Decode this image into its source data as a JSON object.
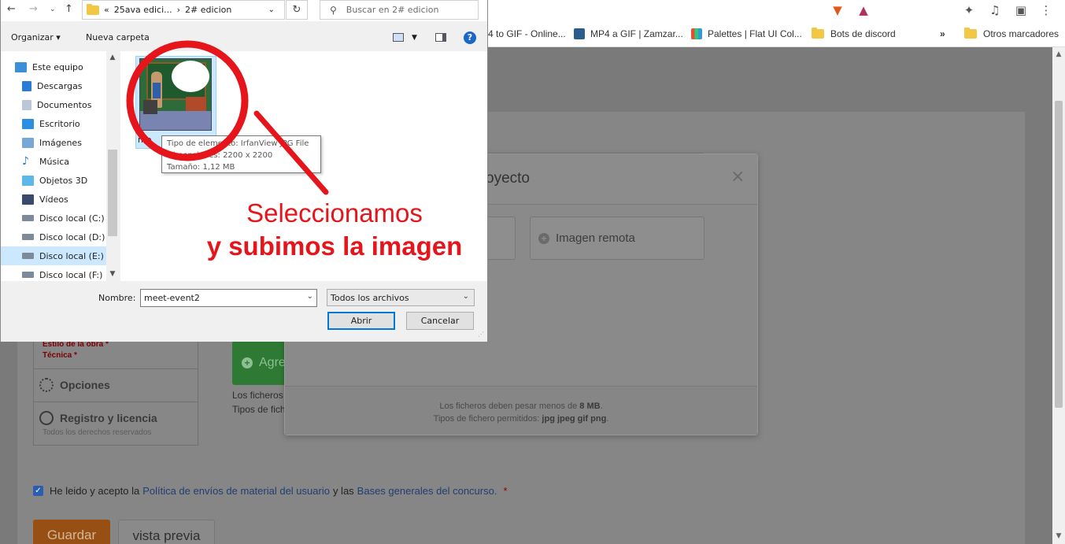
{
  "browser": {
    "bookmarks": [
      {
        "label": "4 to GIF - Online..."
      },
      {
        "label": "MP4 a GIF | Zamzar..."
      },
      {
        "label": "Palettes | Flat UI Col..."
      },
      {
        "label": "Bots de discord"
      },
      {
        "label": "Otros marcadores"
      }
    ],
    "more_bookmarks": "»"
  },
  "dialog": {
    "address": {
      "prefix": "«",
      "segment1": "25ava edici...",
      "separator": "›",
      "segment2": "2# edicion"
    },
    "search_placeholder": "Buscar en 2# edicion",
    "toolbar": {
      "organize": "Organizar",
      "new_folder": "Nueva carpeta",
      "help": "?"
    },
    "tree": [
      {
        "label": "Este equipo"
      },
      {
        "label": "Descargas"
      },
      {
        "label": "Documentos"
      },
      {
        "label": "Escritorio"
      },
      {
        "label": "Imágenes"
      },
      {
        "label": "Música"
      },
      {
        "label": "Objetos 3D"
      },
      {
        "label": "Vídeos"
      },
      {
        "label": "Disco local (C:)"
      },
      {
        "label": "Disco local (D:)"
      },
      {
        "label": "Disco local (E:)"
      },
      {
        "label": "Disco local (F:)"
      }
    ],
    "file": {
      "label": "me"
    },
    "tooltip": {
      "line1": "Tipo de elemento: IrfanView JPG File",
      "line2": "Dimensiones: 2200 x 2200",
      "line3": "Tamaño: 1,12 MB"
    },
    "name_label": "Nombre:",
    "name_value": "meet-event2",
    "file_type": "Todos los archivos",
    "open_label": "Abrir",
    "cancel_label": "Cancelar"
  },
  "modal": {
    "title": "oyecto",
    "close": "×",
    "remote_image_label": "Imagen remota",
    "footer_line1_prefix": "Los ficheros deben pesar menos de",
    "footer_size": "8 MB",
    "footer_line1_suffix": ".",
    "footer_line2_prefix": "Tipos de fichero permitidos:",
    "footer_types": "jpg jpeg gif png",
    "footer_line2_suffix": "."
  },
  "page": {
    "style_label": "Estilo de la obra *",
    "technique_label": "Técnica *",
    "options_title": "Opciones",
    "license_title": "Registro y licencia",
    "license_sub": "Todos los derechos reservados",
    "add_button_label": "Agre",
    "files_note_line1": "Los ficheros",
    "files_note_line2": "Tipos de fich",
    "accept_prefix": "He leido y acepto la",
    "policy_link": "Política de envíos de material del usuario",
    "accept_middle": "y las",
    "rules_link": "Bases generales del concurso.",
    "required_mark": "*",
    "save_label": "Guardar",
    "preview_label": "vista previa"
  },
  "annotation": {
    "line1": "Seleccionamos",
    "line2": "y subimos la imagen",
    "color": "#e5151b"
  }
}
